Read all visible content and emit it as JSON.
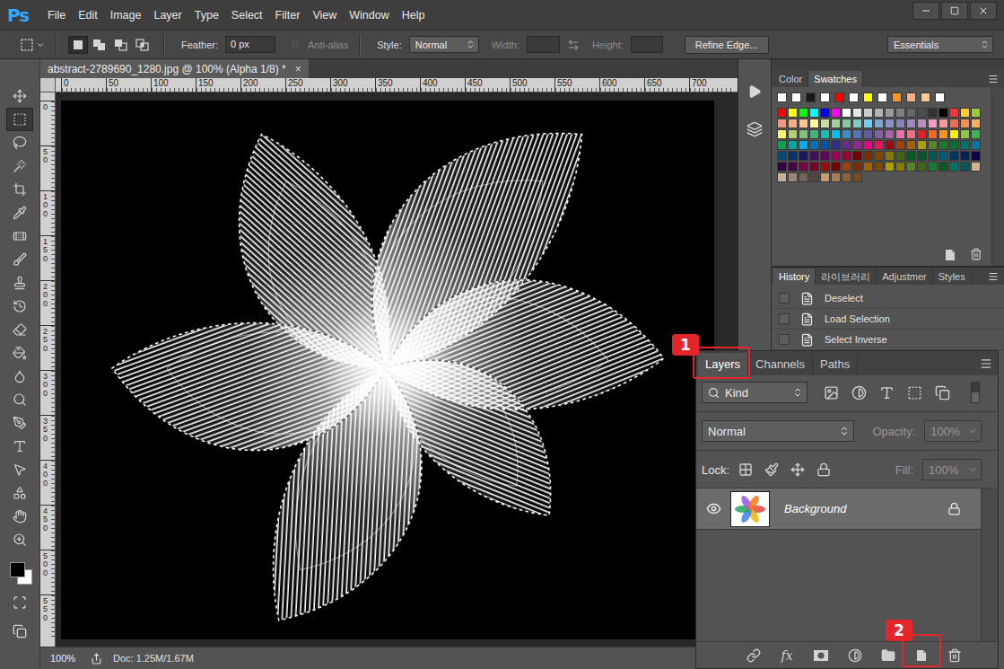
{
  "app": {
    "logo": "Ps"
  },
  "menu": [
    "File",
    "Edit",
    "Image",
    "Layer",
    "Type",
    "Select",
    "Filter",
    "View",
    "Window",
    "Help"
  ],
  "options_bar": {
    "selection_modes": [
      {
        "kind": "new",
        "selected": true
      },
      {
        "kind": "add",
        "selected": false
      },
      {
        "kind": "subtract",
        "selected": false
      },
      {
        "kind": "intersect",
        "selected": false
      }
    ],
    "feather_label": "Feather:",
    "feather_value": "0 px",
    "anti_alias": {
      "label": "Anti-alias",
      "checked": false,
      "disabled": true
    },
    "style_label": "Style:",
    "style_value": "Normal",
    "width_label": "Width:",
    "height_label": "Height:",
    "dims_disabled": true,
    "refine_edge": "Refine Edge...",
    "workspace": "Essentials"
  },
  "tools": [
    {
      "kind": "move",
      "selected": false
    },
    {
      "kind": "marquee",
      "selected": true
    },
    {
      "kind": "lasso",
      "selected": false
    },
    {
      "kind": "quick-selection",
      "selected": false
    },
    {
      "kind": "crop",
      "selected": false
    },
    {
      "kind": "eyedropper",
      "selected": false
    },
    {
      "kind": "healing",
      "selected": false
    },
    {
      "kind": "brush",
      "selected": false
    },
    {
      "kind": "clone-stamp",
      "selected": false
    },
    {
      "kind": "history-brush",
      "selected": false
    },
    {
      "kind": "eraser",
      "selected": false
    },
    {
      "kind": "paint-bucket",
      "selected": false
    },
    {
      "kind": "blur",
      "selected": false
    },
    {
      "kind": "dodge",
      "selected": false
    },
    {
      "kind": "pen",
      "selected": false
    },
    {
      "kind": "type",
      "selected": false
    },
    {
      "kind": "path-selection",
      "selected": false
    },
    {
      "kind": "shape",
      "selected": false
    },
    {
      "kind": "hand",
      "selected": false
    },
    {
      "kind": "zoom",
      "selected": false
    }
  ],
  "colors": {
    "foreground": "#000000",
    "background": "#ffffff"
  },
  "document": {
    "tab_title": "abstract-2789690_1280.jpg @ 100% (Alpha 1/8) *",
    "close": "×",
    "ruler_top": [
      "0",
      "50",
      "100",
      "150",
      "200",
      "250",
      "300",
      "350",
      "400",
      "450",
      "500",
      "550",
      "600",
      "650",
      "700"
    ],
    "ruler_left": [
      "0",
      "50",
      "100",
      "150",
      "200",
      "250",
      "300",
      "350",
      "400",
      "450",
      "500",
      "550"
    ],
    "status": {
      "zoom": "100%",
      "doc": "Doc: 1.25M/1.67M"
    }
  },
  "color_panel": {
    "tabs": [
      {
        "label": "Color",
        "selected": false
      },
      {
        "label": "Swatches",
        "selected": true
      }
    ],
    "swatches_top": [
      "#ffffff",
      "#ffffff",
      "#1a1a1a",
      "#ffffff",
      "#ff0000",
      "#ffffff",
      "#ffff00",
      "#ffffff",
      "#f7941d",
      "#f9ad81",
      "#fdc68a",
      "#ffffff"
    ],
    "swatches": [
      [
        "#ff0000",
        "#ffff00",
        "#00ff00",
        "#00ffff",
        "#0000ff",
        "#ff00ff",
        "#ffffff",
        "#e6e6e6",
        "#cccccc",
        "#b3b3b3",
        "#999999",
        "#808080",
        "#666666",
        "#4d4d4d",
        "#333333",
        "#000000",
        "#ff3333",
        "#ffcc33",
        "#99cc33"
      ],
      [
        "#f7977a",
        "#f9ad81",
        "#fdc68a",
        "#fff79a",
        "#c4df9b",
        "#a2d39c",
        "#82ca9d",
        "#7bcdc8",
        "#6ecff6",
        "#7ea7d8",
        "#8493ca",
        "#8882be",
        "#a187be",
        "#bc8dbf",
        "#f49ac2",
        "#f6989d",
        "#f26c4f",
        "#f68e55",
        "#fbaf5c"
      ],
      [
        "#fff568",
        "#acd372",
        "#7cc576",
        "#3bb878",
        "#1abbb4",
        "#00bff3",
        "#438ccb",
        "#5574b9",
        "#605ca8",
        "#855fa8",
        "#a763a8",
        "#f06ea9",
        "#f26d7d",
        "#ed1c24",
        "#f26522",
        "#f7941d",
        "#fff200",
        "#8dc63f",
        "#39b54a"
      ],
      [
        "#00a651",
        "#00a99d",
        "#00aeef",
        "#0072bc",
        "#0054a6",
        "#2e3192",
        "#662d91",
        "#92278f",
        "#ec008c",
        "#ed145b",
        "#9e0b0f",
        "#a0410d",
        "#a36209",
        "#aba000",
        "#598527",
        "#197b30",
        "#007236",
        "#00746b",
        "#0076a3"
      ],
      [
        "#004b80",
        "#003471",
        "#1b1464",
        "#440e62",
        "#630460",
        "#9e005d",
        "#9e0039",
        "#790000",
        "#7b2e00",
        "#7d4900",
        "#827b00",
        "#406618",
        "#005e20",
        "#005826",
        "#005952",
        "#005b7f",
        "#003663",
        "#002157",
        "#0d004c"
      ],
      [
        "#32004b",
        "#4b0049",
        "#7b0046",
        "#7a0026",
        "#9e0b0f",
        "#790000",
        "#a0410d",
        "#7b2e00",
        "#a36209",
        "#7d4900",
        "#aba000",
        "#827b00",
        "#598527",
        "#406618",
        "#197b30",
        "#005e20",
        "#00746b",
        "#005952",
        "#d2b48c"
      ],
      [
        "#c7b299",
        "#998675",
        "#736357",
        "#534741",
        "#c69c6d",
        "#a67c52",
        "#8c6239",
        "#754c24"
      ]
    ]
  },
  "history_panel": {
    "tabs": [
      {
        "label": "History",
        "selected": true
      },
      {
        "label": "라이브러리",
        "selected": false
      },
      {
        "label": "Adjustmer",
        "selected": false
      },
      {
        "label": "Styles",
        "selected": false
      }
    ],
    "items": [
      {
        "label": "Deselect"
      },
      {
        "label": "Load Selection"
      },
      {
        "label": "Select Inverse"
      }
    ]
  },
  "layers_panel": {
    "tabs": [
      {
        "label": "Layers",
        "selected": true
      },
      {
        "label": "Channels",
        "selected": false
      },
      {
        "label": "Paths",
        "selected": false
      }
    ],
    "filter_label": "Kind",
    "blend_mode": "Normal",
    "opacity_label": "Opacity:",
    "opacity_value": "100%",
    "lock_label": "Lock:",
    "fill_label": "Fill:",
    "fill_value": "100%",
    "controls_disabled": true,
    "layers": [
      {
        "name": "Background",
        "visible": true,
        "locked": true,
        "selected": true
      }
    ],
    "footer_fx": "fx"
  },
  "annotations": [
    {
      "label": "1"
    },
    {
      "label": "2"
    }
  ]
}
